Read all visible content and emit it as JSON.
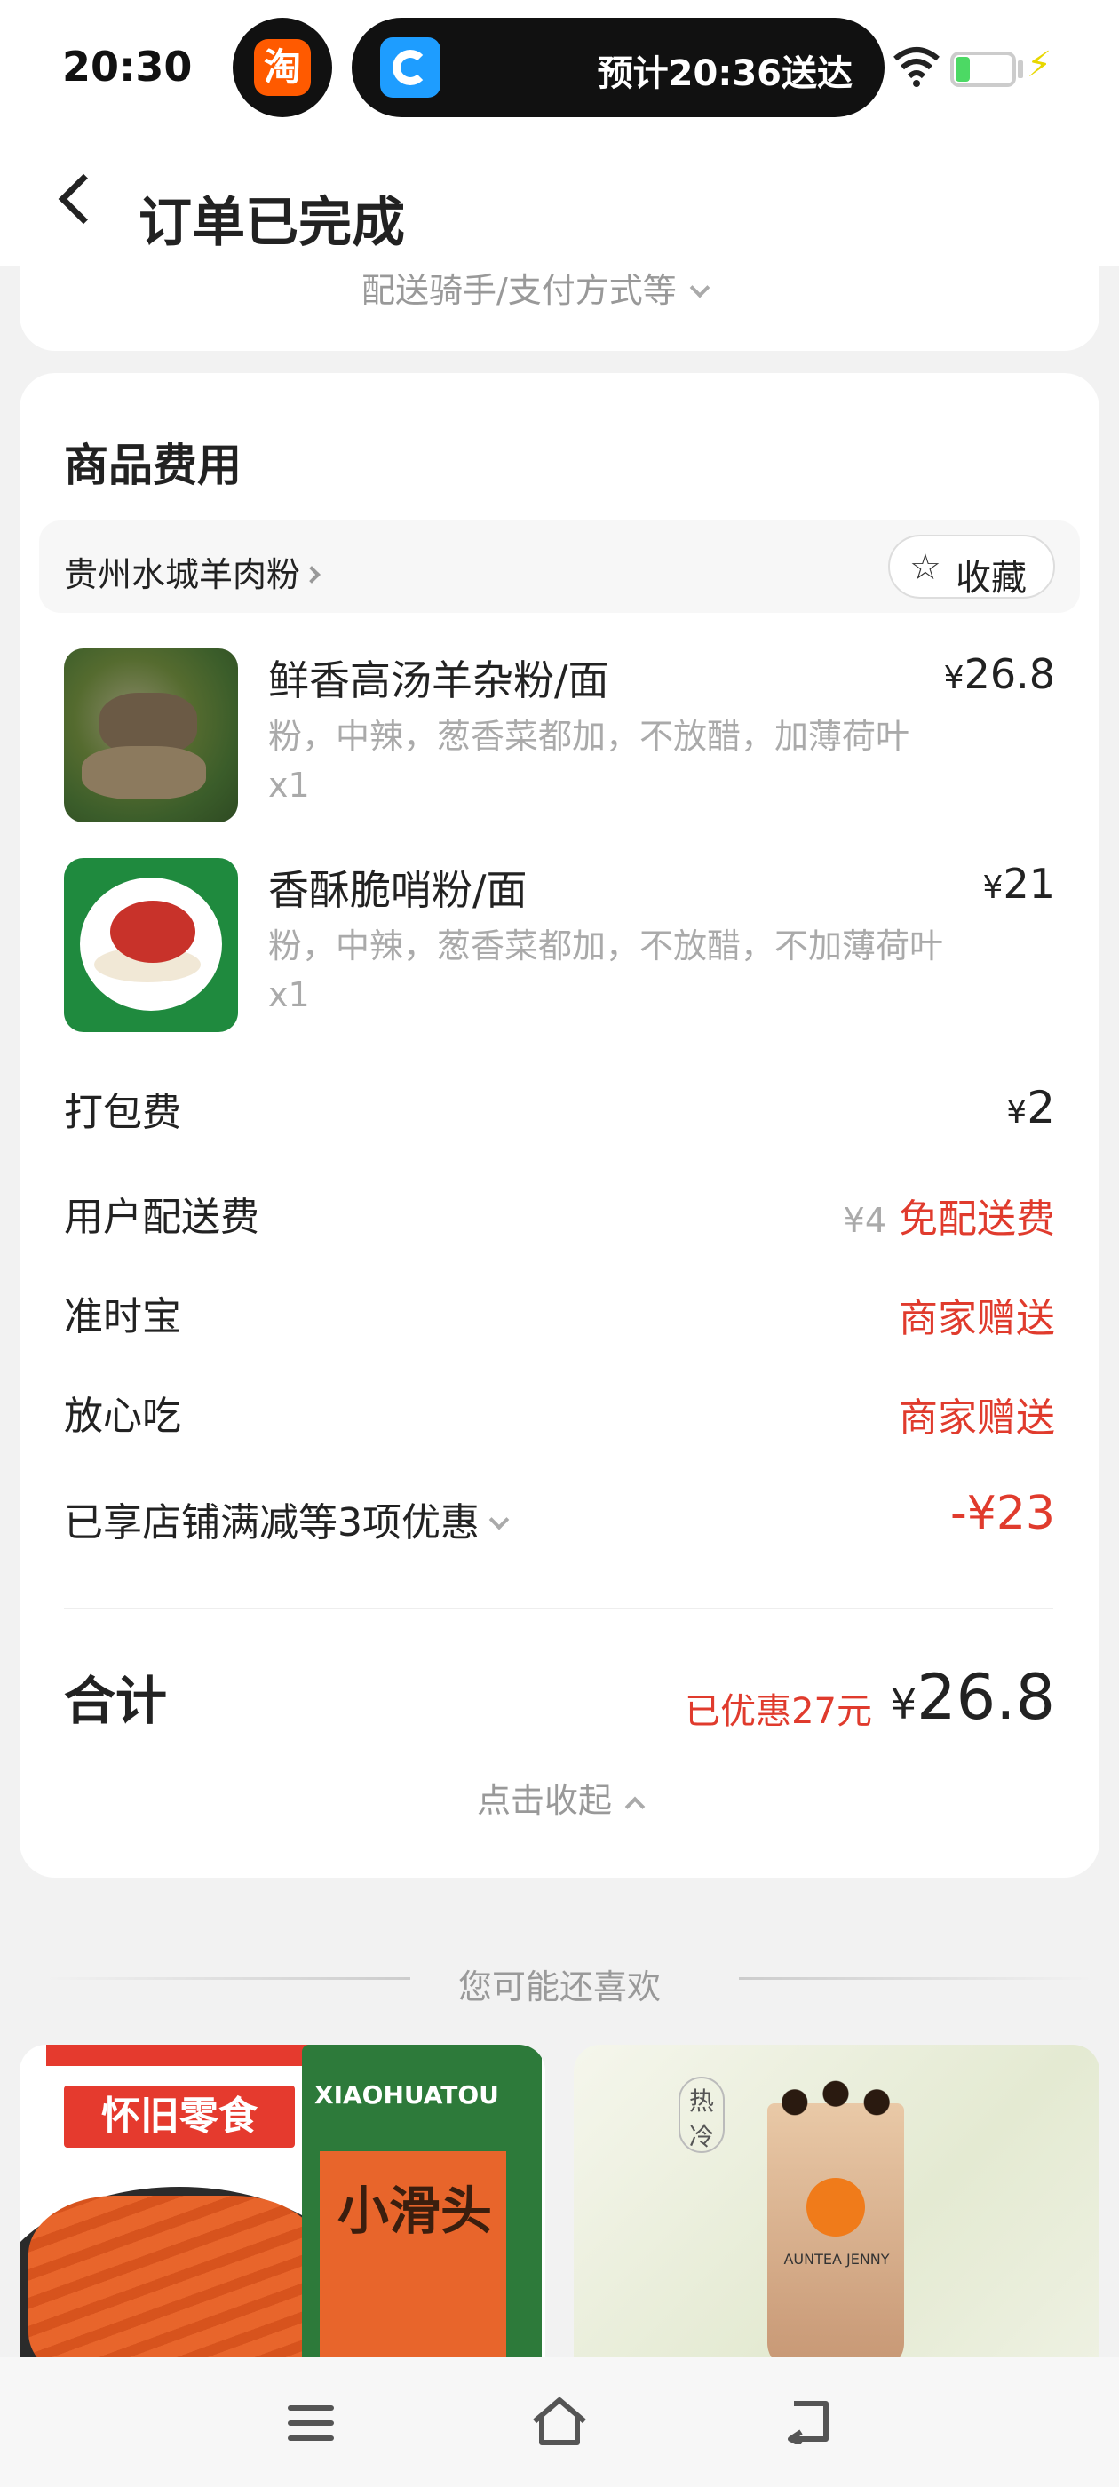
{
  "status_bar": {
    "time": "20:30",
    "taobao_icon_label": "淘",
    "delivery_eta": "预计20:36送达"
  },
  "header": {
    "title": "订单已完成"
  },
  "prev_card": {
    "expand_text": "配送骑手/支付方式等"
  },
  "goods": {
    "section_title": "商品费用",
    "shop_name": "贵州水城羊肉粉",
    "favorite_label": "收藏",
    "items": [
      {
        "name": "鲜香高汤羊杂粉/面",
        "spec": "粉，中辣，葱香菜都加，不放醋，加薄荷叶",
        "qty": "x1",
        "price_symbol": "¥",
        "price": "26.8"
      },
      {
        "name": "香酥脆哨粉/面",
        "spec": "粉，中辣，葱香菜都加，不放醋，不加薄荷叶",
        "qty": "x1",
        "price_symbol": "¥",
        "price": "21"
      }
    ],
    "fees": {
      "packing_label": "打包费",
      "packing_symbol": "¥",
      "packing_value": "2",
      "delivery_label": "用户配送费",
      "delivery_original": "¥4",
      "delivery_value": "免配送费",
      "ontime_label": "准时宝",
      "ontime_value": "商家赠送",
      "safe_label": "放心吃",
      "safe_value": "商家赠送",
      "discount_label": "已享店铺满减等3项优惠",
      "discount_value": "-¥23"
    },
    "total": {
      "label": "合计",
      "saved_text": "已优惠27元",
      "symbol": "¥",
      "value": "26.8"
    },
    "collapse_text": "点击收起"
  },
  "recommend": {
    "title": "您可能还喜欢",
    "card1": {
      "banner": "怀旧零食",
      "pack_brand": "XIAOHUATOU",
      "pack_name": "小滑头"
    },
    "card2": {
      "hot_label": "热",
      "cold_label": "冷",
      "brand_label": "AUNTEA JENNY"
    }
  },
  "colors": {
    "accent_red": "#e03b2d",
    "background": "#f2f2f2",
    "card": "#ffffff"
  },
  "icons": [
    "back-arrow-icon",
    "wifi-icon",
    "battery-icon",
    "star-icon",
    "chevron-right-icon",
    "chevron-down-icon",
    "chevron-up-icon",
    "menu-icon",
    "home-icon",
    "back-nav-icon"
  ]
}
